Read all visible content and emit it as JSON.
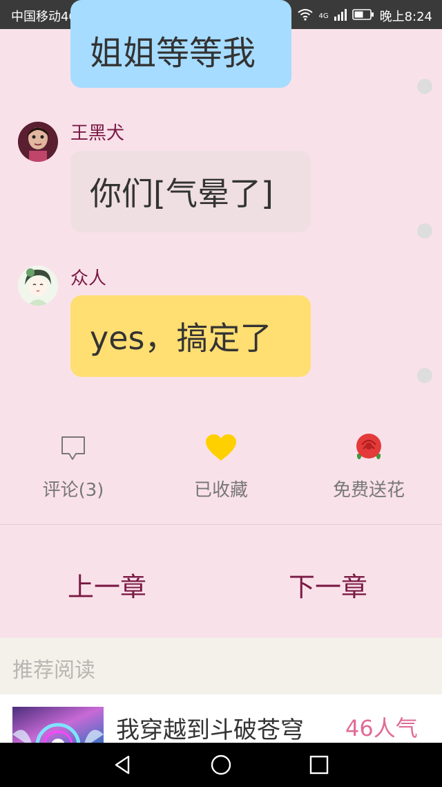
{
  "status_bar": {
    "carrier": "中国移动4G",
    "network": "4G",
    "time": "晚上8:24"
  },
  "messages": [
    {
      "sender": "",
      "text": "姐姐等等我",
      "bubble_color": "#a6dcff"
    },
    {
      "sender": "王黑犬",
      "text": "你们[气晕了]",
      "bubble_color": "#efdfe2"
    },
    {
      "sender": "众人",
      "text": "yes，搞定了",
      "bubble_color": "#ffde72"
    }
  ],
  "actions": {
    "comment": "评论(3)",
    "favorited": "已收藏",
    "flower": "免费送花"
  },
  "chapter_nav": {
    "prev": "上一章",
    "next": "下一章"
  },
  "recommend": {
    "title": "推荐阅读",
    "items": [
      {
        "name": "我穿越到斗破苍穹",
        "popularity": "46人气"
      }
    ]
  },
  "colors": {
    "background": "#f9e1ea",
    "accent": "#7a1a44",
    "popularity": "#e06b96"
  }
}
